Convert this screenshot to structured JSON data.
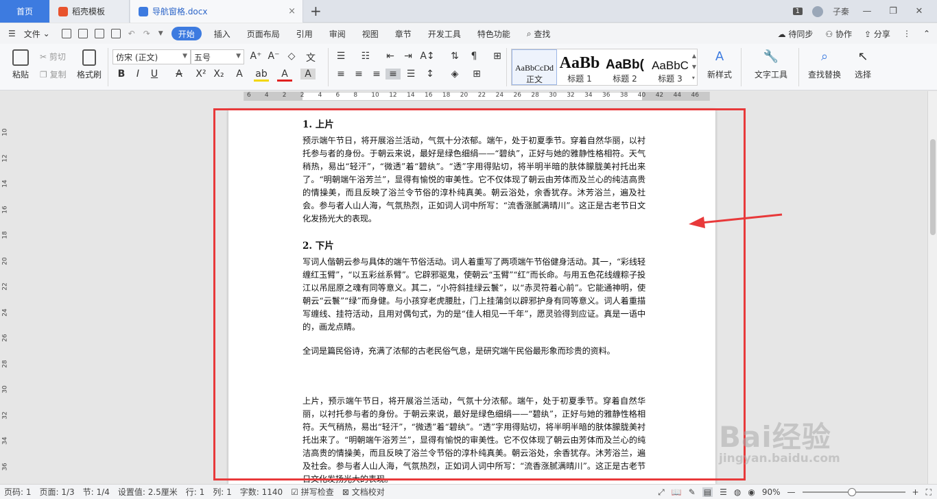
{
  "tabs": {
    "home": "首页",
    "template": "稻壳模板",
    "document": "导航窗格.docx",
    "add": "+",
    "close": "×"
  },
  "titlebar": {
    "badge": "1",
    "user": "子秦",
    "min": "—",
    "restore": "❐",
    "close": "✕"
  },
  "menu": {
    "file": "文件",
    "items": [
      "开始",
      "插入",
      "页面布局",
      "引用",
      "审阅",
      "视图",
      "章节",
      "开发工具",
      "特色功能"
    ],
    "search": "查找",
    "sync": "待同步",
    "collab": "协作",
    "share": "分享"
  },
  "ribbon": {
    "paste": "粘贴",
    "cut": "剪切",
    "copy": "复制",
    "format_painter": "格式刷",
    "font_name": "仿宋 (正文)",
    "font_size": "五号",
    "styles": [
      {
        "preview": "AaBbCcDd",
        "name": "正文"
      },
      {
        "preview": "AaBb",
        "name": "标题 1"
      },
      {
        "preview": "AaBb(",
        "name": "标题 2"
      },
      {
        "preview": "AaBbC",
        "name": "标题 3"
      }
    ],
    "new_style": "新样式",
    "text_tools": "文字工具",
    "find_replace": "查找替换",
    "select": "选择"
  },
  "ruler": {
    "h_ticks": [
      "6",
      "4",
      "2",
      "2",
      "4",
      "6",
      "8",
      "10",
      "12",
      "14",
      "16",
      "18",
      "20",
      "22",
      "24",
      "26",
      "28",
      "30",
      "32",
      "34",
      "36",
      "38",
      "40",
      "42",
      "44",
      "46"
    ],
    "v_ticks": [
      "10",
      "12",
      "14",
      "16",
      "18",
      "20",
      "22",
      "24",
      "26",
      "28",
      "30",
      "32",
      "34",
      "36"
    ]
  },
  "document": {
    "h1": "1. 上片",
    "p1": "预示端午节日，将开展浴兰活动，气氛十分浓郁。端午，处于初夏季节。穿着自然华丽，以衬托参与者的身份。于朝云来说，最好是绿色细绢——“碧纨”，正好与她的雅静性格相符。天气稍热，易出“轻汗”，“微透”着“碧纨”。“透”字用得贴切，将半明半暗的肤体朦胧美衬托出来了。“明朝端午浴芳兰”，显得有愉悦的审美性。它不仅体现了朝云由芳体而及兰心的纯洁高贵的情操美，而且反映了浴兰令节俗的淳朴纯真美。朝云浴处，余香犹存。沐芳浴兰，遍及社会。参与者人山人海，气氛热烈，正如词人词中所写：“流香涨腻满晴川”。这正是古老节日文化发扬光大的表现。",
    "h2": "2. 下片",
    "p2": "写词人偕朝云参与具体的端午节俗活动。词人着重写了两项端午节俗健身活动。其一，“彩线轻缠红玉臂”，“以五彩丝系臂”。它辟邪驱鬼，使朝云“玉臂”“红”而长命。与用五色花线缠粽子投江以吊屈原之魂有同等意义。其二，“小符斜挂绿云鬟”，以“赤灵符着心前”。它能通神明，使朝云“云鬟”“绿”而身健。与小孩穿老虎腰肚，门上挂蒲剑以辟邪护身有同等意义。词人着重描写缠线、挂符活动，且用对偶句式，为的是“佳人相见一千年”，愿灵验得到应证。真是一语中的，画龙点睛。",
    "p3": "全词是篇民俗诗，充满了浓郁的古老民俗气息，是研究端午民俗最形象而珍贵的资料。",
    "p4": "上片，预示端午节日，将开展浴兰活动，气氛十分浓郁。端午，处于初夏季节。穿着自然华丽，以衬托参与者的身份。于朝云来说，最好是绿色细绢——“碧纨”，正好与她的雅静性格相符。天气稍热，易出“轻汗”，“微透”着“碧纨”。“透”字用得贴切，将半明半暗的肤体朦胧美衬托出来了。“明朝端午浴芳兰”，显得有愉悦的审美性。它不仅体现了朝云由芳体而及兰心的纯洁高贵的情操美，而且反映了浴兰令节俗的淳朴纯真美。朝云浴处，余香犹存。沐芳浴兰，遍及社会。参与者人山人海，气氛热烈，正如词人词中所写：“流香涨腻满晴川”。这正是古老节日文化发扬光大的表现。"
  },
  "watermark": {
    "line1": "Bai经验",
    "line2": "jingyan.baidu.com"
  },
  "status": {
    "page_num": "页码: 1",
    "page": "页面: 1/3",
    "section": "节: 1/4",
    "setting": "设置值: 2.5厘米",
    "row": "行: 1",
    "col": "列: 1",
    "words": "字数: 1140",
    "spell": "拼写检查",
    "proof": "文档校对",
    "zoom": "90%",
    "minus": "—",
    "plus": "+"
  },
  "colors": {
    "accent": "#3d7be0",
    "annotation": "#e8393a",
    "wps_red": "#e8532d"
  },
  "zoom_level": 0.9
}
